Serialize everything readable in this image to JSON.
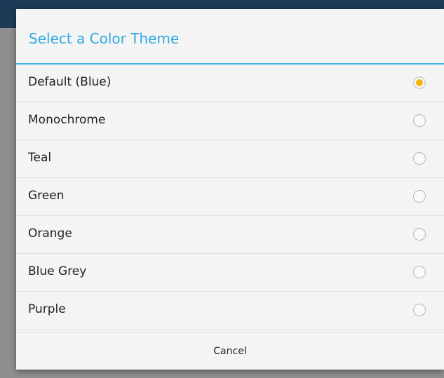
{
  "dialog": {
    "title": "Select a Color Theme",
    "options": [
      {
        "label": "Default (Blue)",
        "selected": true
      },
      {
        "label": "Monochrome",
        "selected": false
      },
      {
        "label": "Teal",
        "selected": false
      },
      {
        "label": "Green",
        "selected": false
      },
      {
        "label": "Orange",
        "selected": false
      },
      {
        "label": "Blue Grey",
        "selected": false
      },
      {
        "label": "Purple",
        "selected": false
      }
    ],
    "cancel_label": "Cancel"
  },
  "colors": {
    "title": "#2faae3",
    "divider": "#3cb7ea",
    "radio_selected": "#f6b40f",
    "app_bar": "#1d3a56"
  }
}
